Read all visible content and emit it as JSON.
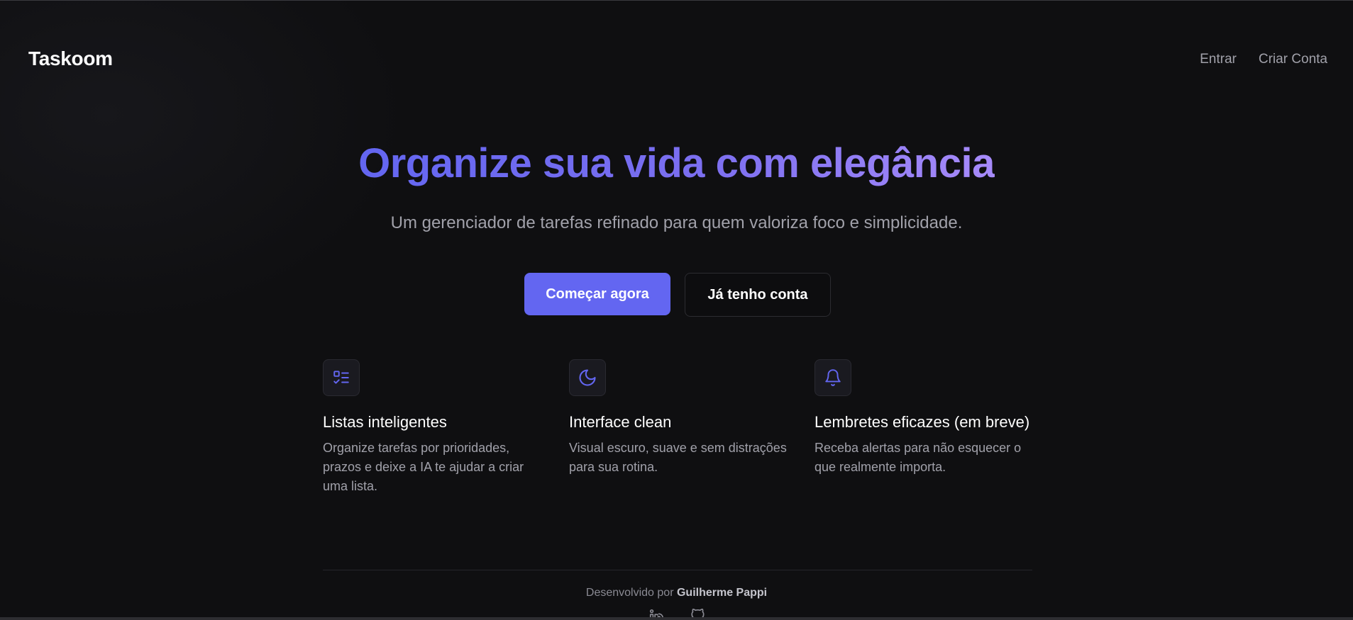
{
  "header": {
    "logo": "Taskoom",
    "nav": {
      "login_label": "Entrar",
      "signup_label": "Criar Conta"
    }
  },
  "hero": {
    "title": "Organize sua vida com elegância",
    "subtitle": "Um gerenciador de tarefas refinado para quem valoriza foco e simplicidade.",
    "primary_cta": "Começar agora",
    "secondary_cta": "Já tenho conta"
  },
  "features": [
    {
      "icon": "list-check-icon",
      "title": "Listas inteligentes",
      "description": "Organize tarefas por prioridades, prazos e deixe a IA te ajudar a criar uma lista."
    },
    {
      "icon": "moon-icon",
      "title": "Interface clean",
      "description": "Visual escuro, suave e sem distrações para sua rotina."
    },
    {
      "icon": "bell-icon",
      "title": "Lembretes eficazes (em breve)",
      "description": "Receba alertas para não esquecer o que realmente importa."
    }
  ],
  "footer": {
    "prefix": "Desenvolvido por",
    "author": "Guilherme Pappi",
    "icons": [
      "linkedin-icon",
      "github-icon"
    ]
  },
  "colors": {
    "accent": "#6366f1",
    "accent_light": "#a78bfa",
    "background": "#0f0f11",
    "muted_text": "#a1a1aa"
  }
}
